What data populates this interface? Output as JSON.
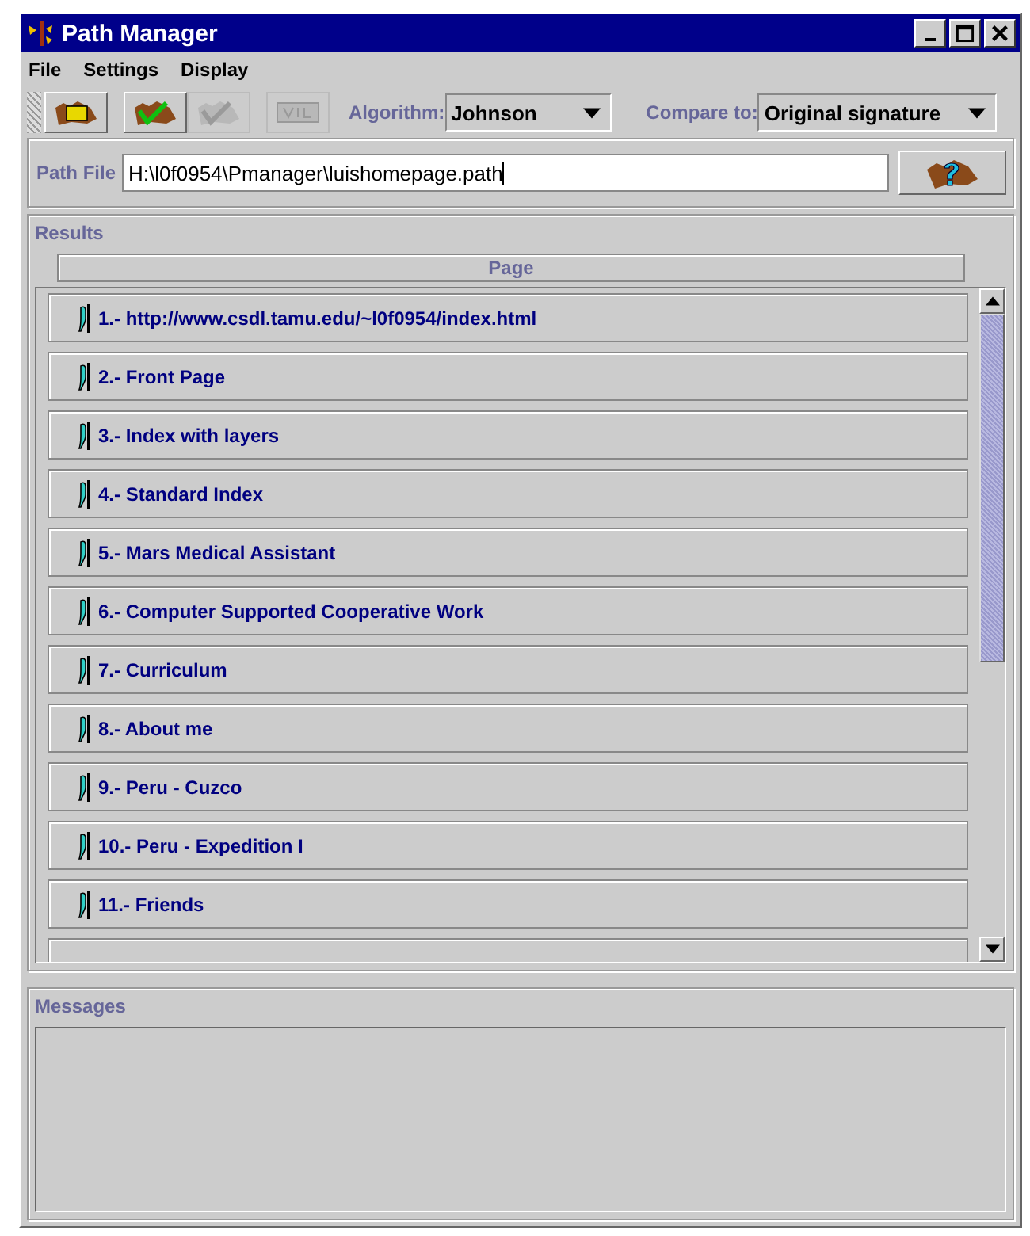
{
  "window": {
    "title": "Path Manager"
  },
  "menu": [
    "File",
    "Settings",
    "Display"
  ],
  "toolbar": [
    {
      "kind": "open",
      "disabled": false
    },
    {
      "kind": "verify",
      "disabled": false
    },
    {
      "kind": "verify",
      "disabled": true
    },
    {
      "kind": "validate",
      "disabled": true
    }
  ],
  "algorithm": {
    "label": "Algorithm:",
    "value": "Johnson"
  },
  "compare": {
    "label": "Compare to:",
    "value": "Original signature"
  },
  "path_file": {
    "label": "Path File",
    "value": "H:\\l0f0954\\Pmanager\\luishomepage.path"
  },
  "results": {
    "title": "Results",
    "column": "Page",
    "rows": [
      {
        "text": "1.- http://www.csdl.tamu.edu/~l0f0954/index.html"
      },
      {
        "text": "2.- Front Page"
      },
      {
        "text": "3.- Index with layers"
      },
      {
        "text": "4.- Standard Index"
      },
      {
        "text": "5.- Mars Medical Assistant"
      },
      {
        "text": "6.- Computer Supported Cooperative Work"
      },
      {
        "text": "7.- Curriculum"
      },
      {
        "text": "8.- About me"
      },
      {
        "text": "9.- Peru - Cuzco"
      },
      {
        "text": "10.- Peru - Expedition I"
      },
      {
        "text": "11.- Friends"
      }
    ]
  },
  "messages": {
    "title": "Messages"
  }
}
